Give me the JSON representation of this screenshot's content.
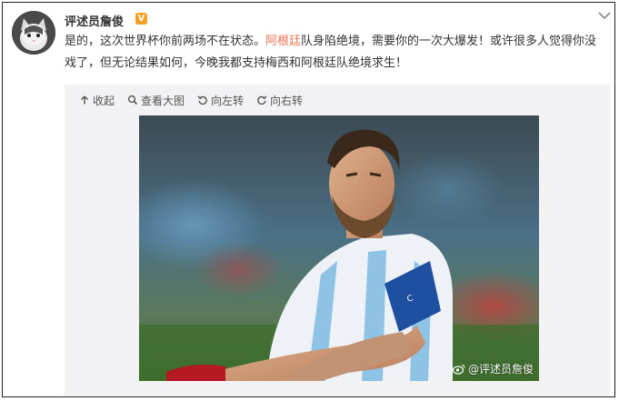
{
  "post": {
    "author": "评述员詹俊",
    "verified_badge": "V",
    "text_part1": "是的，这次世界杯你前两场不在状态。",
    "hashtag": "阿根廷",
    "text_part2": "队身陷绝境，需要你的一次大爆发！或许很多人觉得你没戏了，但无论结果如何，今晚我都支持梅西和阿根廷队绝境求生！",
    "highlight_color": "#eb7350"
  },
  "media": {
    "toolbar": {
      "collapse": "收起",
      "view_large": "查看大图",
      "rotate_left": "向左转",
      "rotate_right": "向右转"
    },
    "watermark": "@评述员詹俊"
  }
}
